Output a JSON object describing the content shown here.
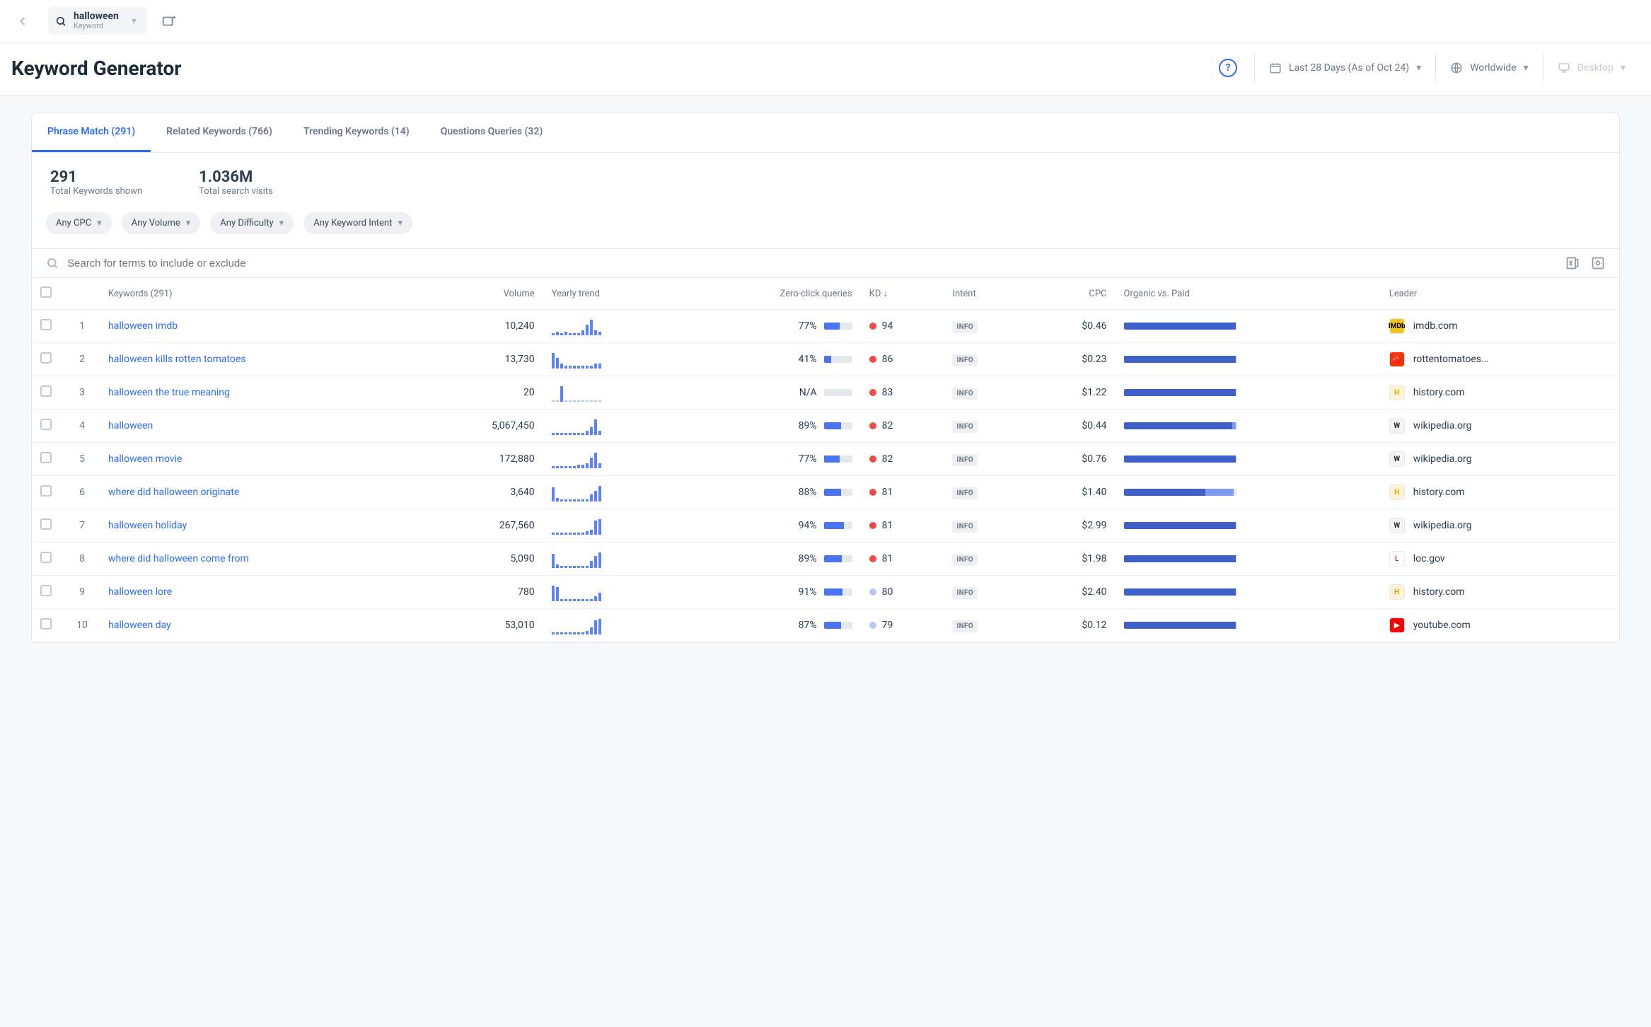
{
  "topbar": {
    "keyword": "halloween",
    "keyword_sub": "Keyword"
  },
  "header": {
    "title": "Keyword Generator",
    "date_range": "Last 28 Days (As of Oct 24)",
    "region": "Worldwide",
    "device": "Desktop"
  },
  "tabs": [
    {
      "label": "Phrase Match (291)",
      "active": true
    },
    {
      "label": "Related Keywords (766)",
      "active": false
    },
    {
      "label": "Trending Keywords (14)",
      "active": false
    },
    {
      "label": "Questions Queries (32)",
      "active": false
    }
  ],
  "stats": {
    "total_keywords_value": "291",
    "total_keywords_label": "Total Keywords shown",
    "total_visits_value": "1.036M",
    "total_visits_label": "Total search visits"
  },
  "filters": [
    "Any CPC",
    "Any Volume",
    "Any Difficulty",
    "Any Keyword Intent"
  ],
  "search_placeholder": "Search for terms to include or exclude",
  "columns": {
    "keywords": "Keywords (291)",
    "volume": "Volume",
    "trend": "Yearly trend",
    "zero": "Zero-click queries",
    "kd": "KD",
    "intent": "Intent",
    "cpc": "CPC",
    "org": "Organic vs. Paid",
    "leader": "Leader"
  },
  "rows": [
    {
      "idx": "1",
      "kw": "halloween imdb",
      "vol": "10,240",
      "trend": [
        1,
        2,
        1,
        2,
        1,
        1,
        1,
        3,
        6,
        9,
        3,
        2
      ],
      "zero": "77%",
      "zpct": 55,
      "kd": "94",
      "kdc": "red",
      "intent": "INFO",
      "cpc": "$0.46",
      "org": 99,
      "paid": 0,
      "leader": "imdb.com",
      "favbg": "#f5c518",
      "favfg": "#000",
      "favtxt": "IMDb"
    },
    {
      "idx": "2",
      "kw": "halloween kills rotten tomatoes",
      "vol": "13,730",
      "trend": [
        6,
        4,
        2,
        1,
        1,
        1,
        1,
        1,
        1,
        1,
        2,
        2
      ],
      "zero": "41%",
      "zpct": 25,
      "kd": "86",
      "kdc": "red",
      "intent": "INFO",
      "cpc": "$0.23",
      "org": 99,
      "paid": 0,
      "leader": "rottentomatoes...",
      "favbg": "#fa320a",
      "favfg": "#fff",
      "favtxt": "🍅"
    },
    {
      "idx": "3",
      "kw": "halloween the true meaning",
      "vol": "20",
      "trend": [
        0,
        0,
        9,
        0,
        0,
        0,
        0,
        0,
        0,
        0,
        0,
        0
      ],
      "zero": "N/A",
      "zpct": 0,
      "kd": "83",
      "kdc": "red",
      "intent": "INFO",
      "cpc": "$1.22",
      "org": 99,
      "paid": 0,
      "leader": "history.com",
      "favbg": "#fff3d6",
      "favfg": "#d8a400",
      "favtxt": "H"
    },
    {
      "idx": "4",
      "kw": "halloween",
      "vol": "5,067,450",
      "trend": [
        1,
        1,
        1,
        1,
        1,
        1,
        1,
        1,
        2,
        4,
        8,
        2
      ],
      "zero": "89%",
      "zpct": 62,
      "kd": "82",
      "kdc": "red",
      "intent": "INFO",
      "cpc": "$0.44",
      "org": 96,
      "paid": 3,
      "leader": "wikipedia.org",
      "favbg": "#f5f5f5",
      "favfg": "#222",
      "favtxt": "W"
    },
    {
      "idx": "5",
      "kw": "halloween movie",
      "vol": "172,880",
      "trend": [
        1,
        1,
        1,
        1,
        1,
        1,
        2,
        2,
        3,
        6,
        9,
        3
      ],
      "zero": "77%",
      "zpct": 55,
      "kd": "82",
      "kdc": "red",
      "intent": "INFO",
      "cpc": "$0.76",
      "org": 99,
      "paid": 0,
      "leader": "wikipedia.org",
      "favbg": "#f5f5f5",
      "favfg": "#222",
      "favtxt": "W"
    },
    {
      "idx": "6",
      "kw": "where did halloween originate",
      "vol": "3,640",
      "trend": [
        8,
        2,
        1,
        1,
        1,
        1,
        1,
        1,
        1,
        4,
        6,
        9
      ],
      "zero": "88%",
      "zpct": 62,
      "kd": "81",
      "kdc": "red",
      "intent": "INFO",
      "cpc": "$1.40",
      "org": 72,
      "paid": 25,
      "leader": "history.com",
      "favbg": "#fff3d6",
      "favfg": "#d8a400",
      "favtxt": "H"
    },
    {
      "idx": "7",
      "kw": "halloween holiday",
      "vol": "267,560",
      "trend": [
        1,
        1,
        1,
        1,
        1,
        1,
        1,
        1,
        2,
        3,
        8,
        9
      ],
      "zero": "94%",
      "zpct": 72,
      "kd": "81",
      "kdc": "red",
      "intent": "INFO",
      "cpc": "$2.99",
      "org": 99,
      "paid": 0,
      "leader": "wikipedia.org",
      "favbg": "#f5f5f5",
      "favfg": "#222",
      "favtxt": "W"
    },
    {
      "idx": "8",
      "kw": "where did halloween come from",
      "vol": "5,090",
      "trend": [
        8,
        2,
        1,
        1,
        1,
        1,
        1,
        1,
        1,
        4,
        7,
        9
      ],
      "zero": "89%",
      "zpct": 63,
      "kd": "81",
      "kdc": "red",
      "intent": "INFO",
      "cpc": "$1.98",
      "org": 99,
      "paid": 0,
      "leader": "loc.gov",
      "favbg": "#fff",
      "favfg": "#c33",
      "favtxt": "L"
    },
    {
      "idx": "9",
      "kw": "halloween lore",
      "vol": "780",
      "trend": [
        9,
        8,
        1,
        1,
        1,
        1,
        1,
        1,
        1,
        1,
        3,
        5
      ],
      "zero": "91%",
      "zpct": 65,
      "kd": "80",
      "kdc": "lite",
      "intent": "INFO",
      "cpc": "$2.40",
      "org": 99,
      "paid": 0,
      "leader": "history.com",
      "favbg": "#fff3d6",
      "favfg": "#d8a400",
      "favtxt": "H"
    },
    {
      "idx": "10",
      "kw": "halloween day",
      "vol": "53,010",
      "trend": [
        1,
        1,
        1,
        1,
        1,
        1,
        1,
        1,
        2,
        4,
        8,
        9
      ],
      "zero": "87%",
      "zpct": 62,
      "kd": "79",
      "kdc": "lite",
      "intent": "INFO",
      "cpc": "$0.12",
      "org": 99,
      "paid": 0,
      "leader": "youtube.com",
      "favbg": "#ff0000",
      "favfg": "#fff",
      "favtxt": "▶"
    }
  ]
}
